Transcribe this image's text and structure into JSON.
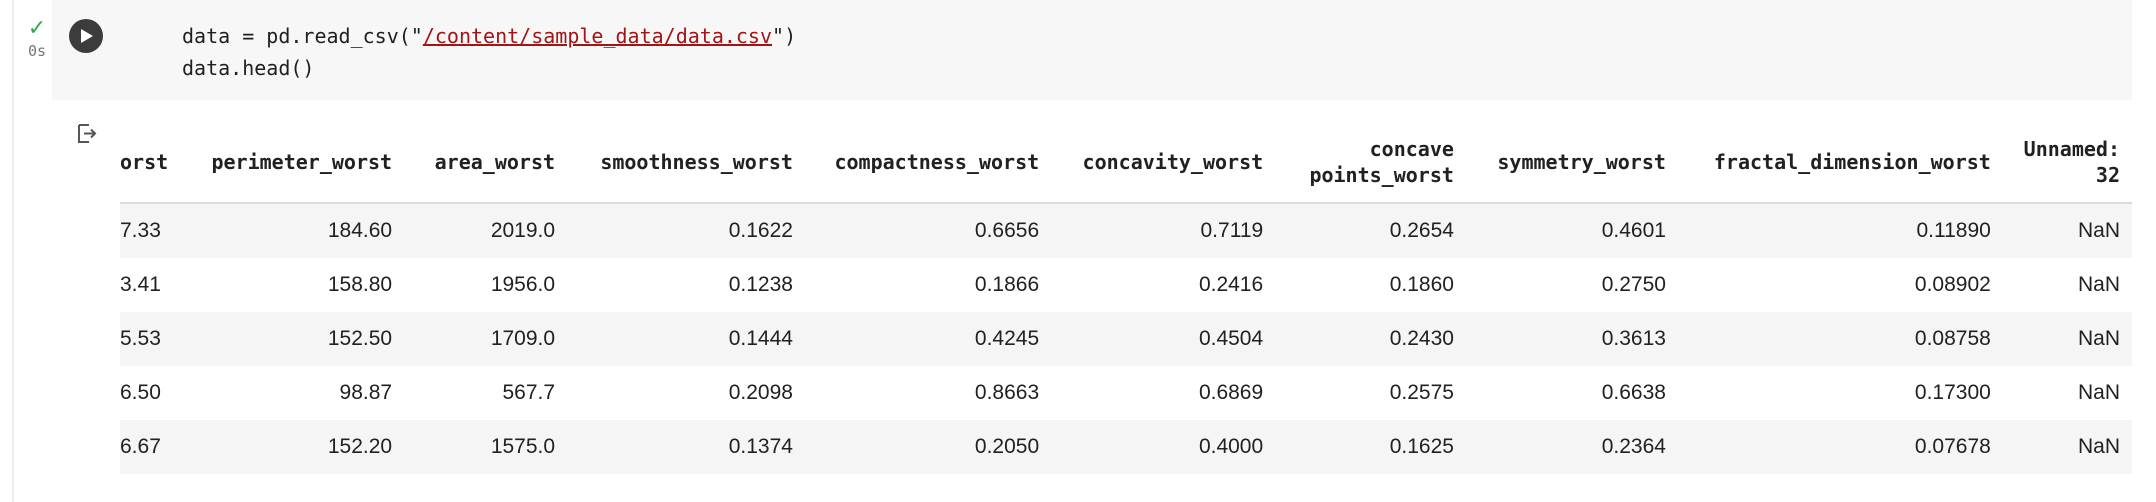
{
  "cell": {
    "status_check": "✓",
    "status_time": "0s",
    "code_line1_prefix": "data = pd.read_csv(\"",
    "code_line1_path": "/content/sample_data/data.csv",
    "code_line1_suffix": "\")",
    "code_line2": "data.head()"
  },
  "icons": {
    "run": "play-icon",
    "output": "output-redirect-icon"
  },
  "table": {
    "headers": [
      [
        "orst"
      ],
      [
        "perimeter_worst"
      ],
      [
        "area_worst"
      ],
      [
        "smoothness_worst"
      ],
      [
        "compactness_worst"
      ],
      [
        "concavity_worst"
      ],
      [
        "concave",
        "points_worst"
      ],
      [
        "symmetry_worst"
      ],
      [
        "fractal_dimension_worst"
      ],
      [
        "Unnamed:",
        "32"
      ]
    ],
    "rows": [
      [
        "7.33",
        "184.60",
        "2019.0",
        "0.1622",
        "0.6656",
        "0.7119",
        "0.2654",
        "0.4601",
        "0.11890",
        "NaN"
      ],
      [
        "3.41",
        "158.80",
        "1956.0",
        "0.1238",
        "0.1866",
        "0.2416",
        "0.1860",
        "0.2750",
        "0.08902",
        "NaN"
      ],
      [
        "5.53",
        "152.50",
        "1709.0",
        "0.1444",
        "0.4245",
        "0.4504",
        "0.2430",
        "0.3613",
        "0.08758",
        "NaN"
      ],
      [
        "6.50",
        "98.87",
        "567.7",
        "0.2098",
        "0.8663",
        "0.6869",
        "0.2575",
        "0.6638",
        "0.17300",
        "NaN"
      ],
      [
        "6.67",
        "152.20",
        "1575.0",
        "0.1374",
        "0.2050",
        "0.4000",
        "0.1625",
        "0.2364",
        "0.07678",
        "NaN"
      ]
    ]
  }
}
